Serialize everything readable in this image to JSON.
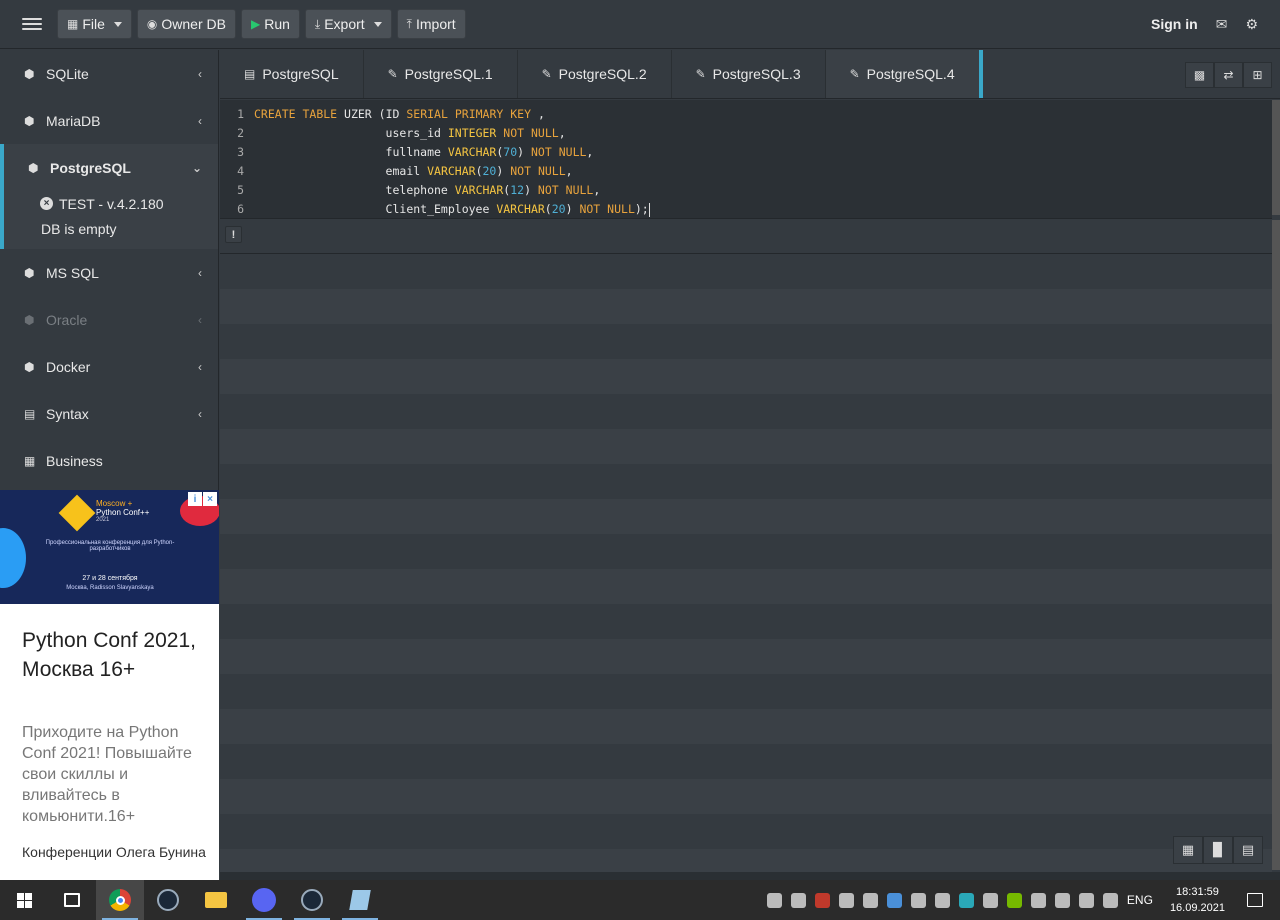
{
  "toolbar": {
    "file": "File",
    "owner_db": "Owner DB",
    "run": "Run",
    "export": "Export",
    "import": "Import",
    "sign_in": "Sign in"
  },
  "sidebar": {
    "items": [
      {
        "label": "SQLite",
        "icon": "cube-icon"
      },
      {
        "label": "MariaDB",
        "icon": "cube-icon"
      },
      {
        "label": "PostgreSQL",
        "icon": "cube-icon"
      },
      {
        "label": "MS SQL",
        "icon": "cube-icon"
      },
      {
        "label": "Oracle",
        "icon": "cube-icon"
      },
      {
        "label": "Docker",
        "icon": "cube-icon"
      },
      {
        "label": "Syntax",
        "icon": "book-icon"
      },
      {
        "label": "Business",
        "icon": "building-icon"
      }
    ],
    "db_version": "TEST - v.4.2.180",
    "db_status": "DB is empty"
  },
  "ad": {
    "banner_line1": "Moscow +",
    "banner_line2": "Python Conf++",
    "banner_line3": "2021",
    "banner_subtitle": "Профессиональная конференция для Python-разработчиков",
    "banner_dates": "27 и 28 сентября",
    "banner_place": "Москва, Radisson Slavyanskaya",
    "title": "Python Conf 2021, Москва 16+",
    "description": "Приходите на Python Conf 2021! Повышайте свои скиллы и вливайтесь в комьюнити.16+",
    "source": "Конференции Олега Бунина"
  },
  "tabs": [
    {
      "label": "PostgreSQL",
      "icon": "table-icon"
    },
    {
      "label": "PostgreSQL.1",
      "icon": "edit-icon"
    },
    {
      "label": "PostgreSQL.2",
      "icon": "edit-icon"
    },
    {
      "label": "PostgreSQL.3",
      "icon": "edit-icon"
    },
    {
      "label": "PostgreSQL.4",
      "icon": "edit-icon"
    }
  ],
  "editor": {
    "line_numbers": [
      "1",
      "2",
      "3",
      "4",
      "5",
      "6"
    ],
    "lines": [
      "CREATE TABLE UZER (ID SERIAL PRIMARY KEY ,",
      "                   users_id INTEGER NOT NULL,",
      "                   fullname VARCHAR(70) NOT NULL,",
      "                   email VARCHAR(20) NOT NULL,",
      "                   telephone VARCHAR(12) NOT NULL,",
      "                   Client_Employee VARCHAR(20) NOT NULL);"
    ]
  },
  "taskbar": {
    "language": "ENG",
    "time": "18:31:59",
    "date": "16.09.2021"
  },
  "colors": {
    "accent": "#3aa8c9",
    "background": "#343a40",
    "keyword": "#e8a33d",
    "number": "#4fb0d6",
    "run_icon": "#28c76f"
  }
}
